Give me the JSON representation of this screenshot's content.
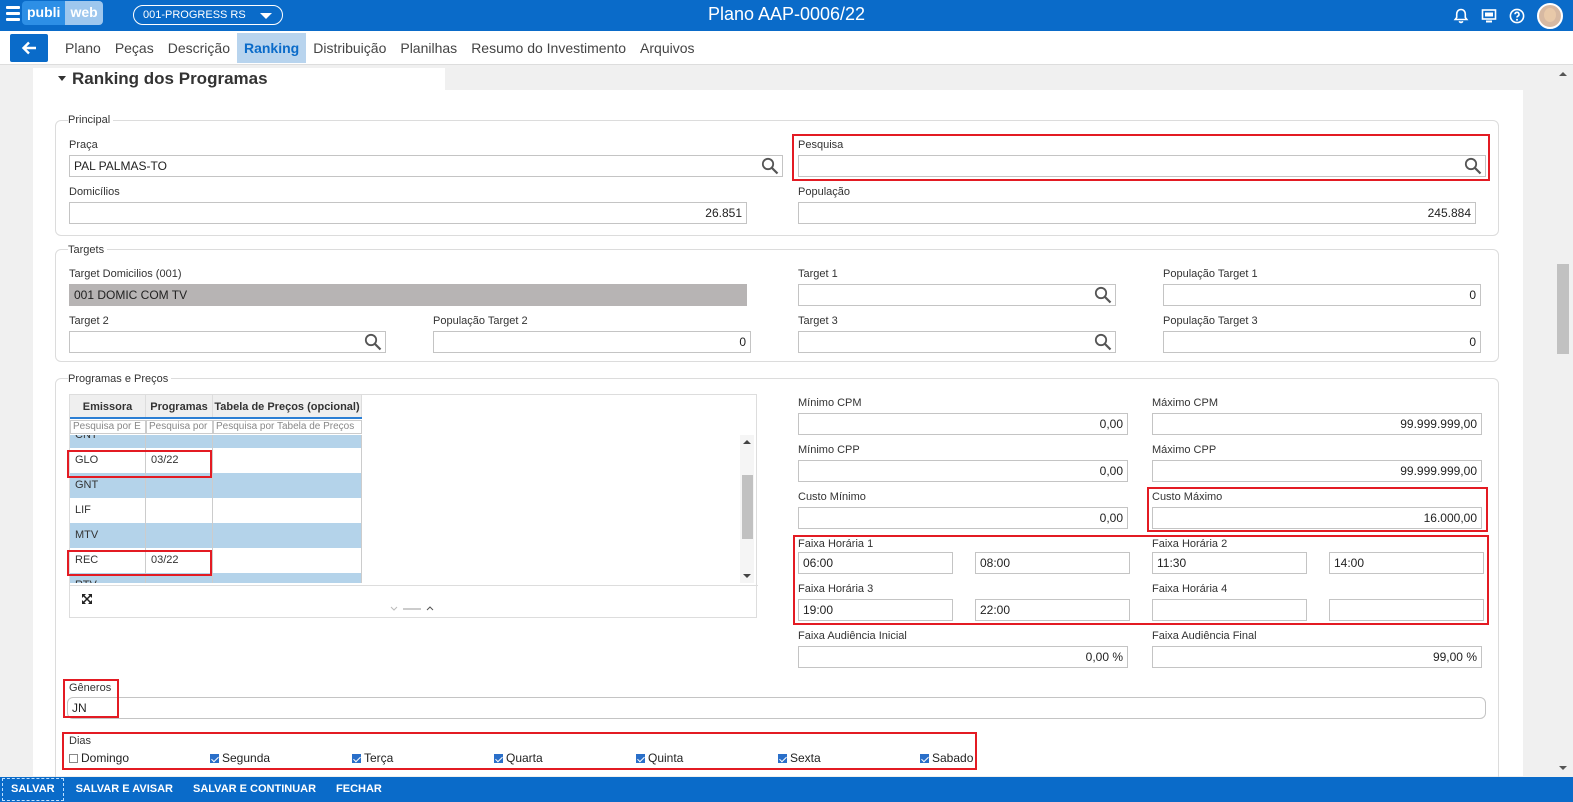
{
  "header": {
    "logo_part1": "publi",
    "logo_part2": "web",
    "company": "001-PROGRESS RS",
    "title": "Plano AAP-0006/22",
    "icons": [
      "bell-icon",
      "monitor-icon",
      "help-icon",
      "avatar"
    ]
  },
  "tabs": [
    {
      "label": "Plano",
      "active": false
    },
    {
      "label": "Peças",
      "active": false
    },
    {
      "label": "Descrição",
      "active": false
    },
    {
      "label": "Ranking",
      "active": true
    },
    {
      "label": "Distribuição",
      "active": false
    },
    {
      "label": "Planilhas",
      "active": false
    },
    {
      "label": "Resumo do Investimento",
      "active": false
    },
    {
      "label": "Arquivos",
      "active": false
    }
  ],
  "section": {
    "title": "Ranking dos Programas"
  },
  "principal": {
    "legend": "Principal",
    "praca_label": "Praça",
    "praca_value": "PAL PALMAS-TO",
    "pesquisa_label": "Pesquisa",
    "pesquisa_value": "",
    "domicilios_label": "Domicílios",
    "domicilios_value": "26.851",
    "populacao_label": "População",
    "populacao_value": "245.884"
  },
  "targets": {
    "legend": "Targets",
    "target_dom_label": "Target Domicilios (001)",
    "target_dom_value": "001 DOMIC COM TV",
    "target1_label": "Target 1",
    "target1_value": "",
    "pop_target1_label": "População Target 1",
    "pop_target1_value": "0",
    "target2_label": "Target 2",
    "target2_value": "",
    "pop_target2_label": "População Target 2",
    "pop_target2_value": "0",
    "target3_label": "Target 3",
    "target3_value": "",
    "pop_target3_label": "População Target 3",
    "pop_target3_value": "0"
  },
  "programas": {
    "legend": "Programas e Preços",
    "grid": {
      "columns": [
        "Emissora",
        "Programas",
        "Tabela de Preços (opcional)"
      ],
      "filters": [
        "Pesquisa por E",
        "Pesquisa por",
        "Pesquisa por Tabela de Preços"
      ],
      "rows": [
        {
          "emissora": "CNT",
          "programas": "",
          "tabela": ""
        },
        {
          "emissora": "GLO",
          "programas": "03/22",
          "tabela": ""
        },
        {
          "emissora": "GNT",
          "programas": "",
          "tabela": ""
        },
        {
          "emissora": "LIF",
          "programas": "",
          "tabela": ""
        },
        {
          "emissora": "MTV",
          "programas": "",
          "tabela": ""
        },
        {
          "emissora": "REC",
          "programas": "03/22",
          "tabela": ""
        },
        {
          "emissora": "RTV",
          "programas": "",
          "tabela": ""
        }
      ]
    },
    "min_cpm_label": "Mínimo CPM",
    "min_cpm_value": "0,00",
    "max_cpm_label": "Máximo CPM",
    "max_cpm_value": "99.999.999,00",
    "min_cpp_label": "Mínimo CPP",
    "min_cpp_value": "0,00",
    "max_cpp_label": "Máximo CPP",
    "max_cpp_value": "99.999.999,00",
    "custo_min_label": "Custo Mínimo",
    "custo_min_value": "0,00",
    "custo_max_label": "Custo Máximo",
    "custo_max_value": "16.000,00",
    "faixa1_label": "Faixa Horária 1",
    "faixa1_ini": "06:00",
    "faixa1_fim": "08:00",
    "faixa2_label": "Faixa Horária 2",
    "faixa2_ini": "11:30",
    "faixa2_fim": "14:00",
    "faixa3_label": "Faixa Horária 3",
    "faixa3_ini": "19:00",
    "faixa3_fim": "22:00",
    "faixa4_label": "Faixa Horária 4",
    "faixa4_ini": "",
    "faixa4_fim": "",
    "aud_ini_label": "Faixa Audiência Inicial",
    "aud_ini_value": "0,00 %",
    "aud_fim_label": "Faixa Audiência Final",
    "aud_fim_value": "99,00 %",
    "generos_label": "Gêneros",
    "generos_value": "JN",
    "dias_label": "Dias",
    "dias": [
      {
        "label": "Domingo",
        "checked": false
      },
      {
        "label": "Segunda",
        "checked": true
      },
      {
        "label": "Terça",
        "checked": true
      },
      {
        "label": "Quarta",
        "checked": true
      },
      {
        "label": "Quinta",
        "checked": true
      },
      {
        "label": "Sexta",
        "checked": true
      },
      {
        "label": "Sabado",
        "checked": true
      }
    ]
  },
  "footer": {
    "salvar": "SALVAR",
    "salvar_avisar": "SALVAR E AVISAR",
    "salvar_continuar": "SALVAR E CONTINUAR",
    "fechar": "FECHAR"
  },
  "colors": {
    "primary": "#0a6bc9",
    "highlight": "#e31b23",
    "row_blue": "#b4d3ea",
    "tab_active_bg": "#b8d4ee"
  }
}
